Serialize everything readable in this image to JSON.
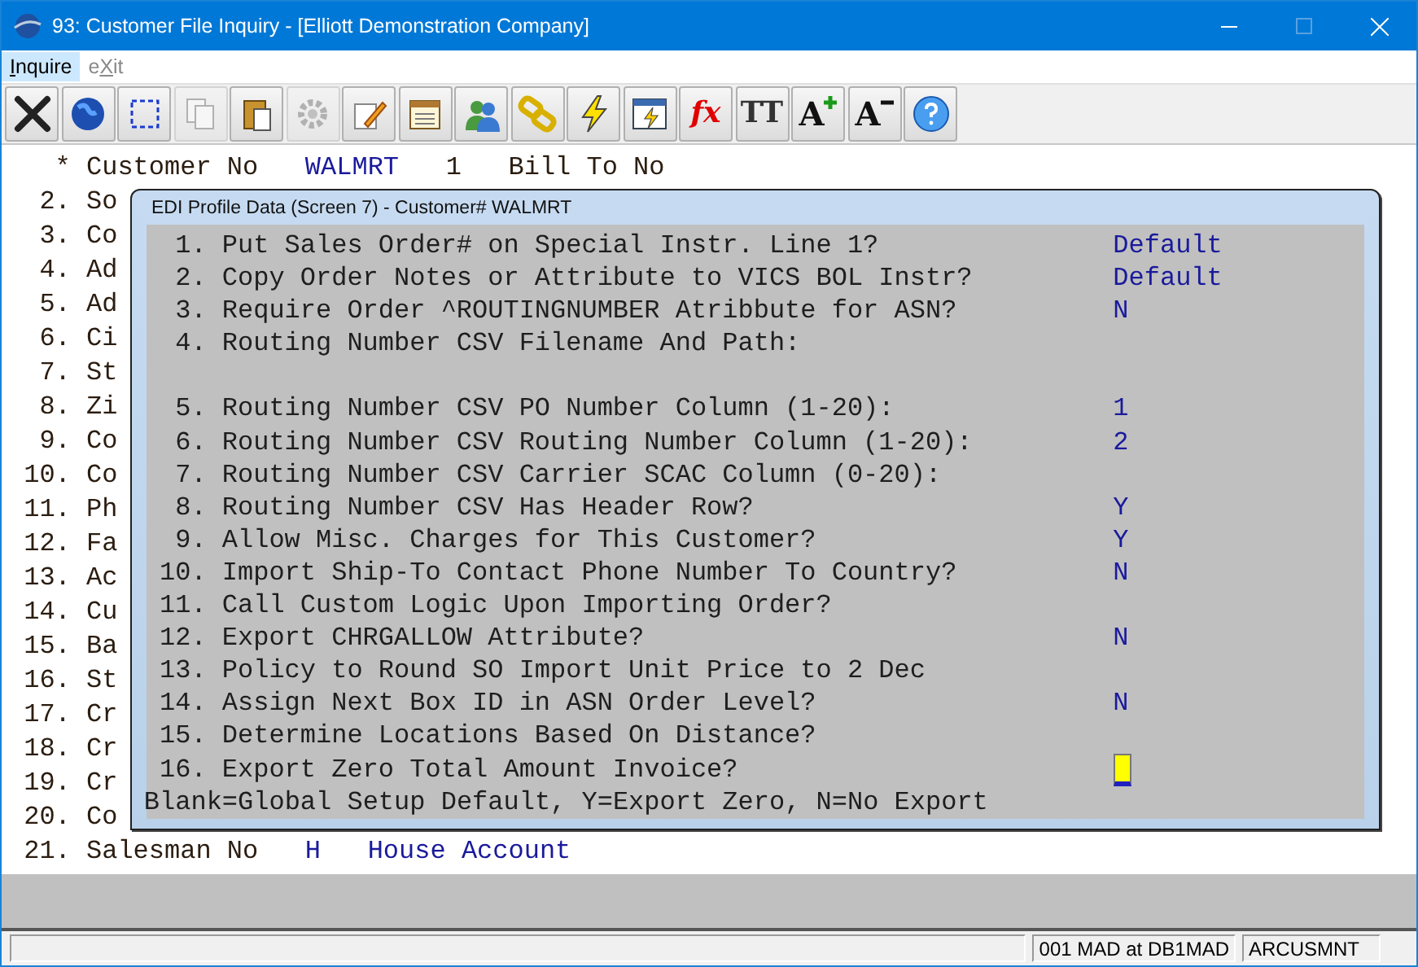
{
  "window": {
    "title": "93: Customer File Inquiry - [Elliott Demonstration Company]"
  },
  "menu": [
    {
      "key": "I",
      "after": "nquire",
      "selected": true,
      "disabled": false
    },
    {
      "before": "e",
      "key": "X",
      "after": "it",
      "selected": false,
      "disabled": true
    }
  ],
  "toolbar": [
    {
      "kind": "close",
      "disabled": false
    },
    {
      "kind": "globe",
      "disabled": false
    },
    {
      "kind": "select",
      "disabled": false
    },
    {
      "kind": "copy",
      "disabled": true
    },
    {
      "kind": "paste",
      "disabled": false
    },
    {
      "kind": "gear",
      "disabled": true
    },
    {
      "kind": "pencil",
      "disabled": false
    },
    {
      "kind": "list",
      "disabled": false
    },
    {
      "kind": "users",
      "disabled": false
    },
    {
      "kind": "link",
      "disabled": false
    },
    {
      "kind": "bolt",
      "disabled": false
    },
    {
      "kind": "window-bolt",
      "disabled": false
    },
    {
      "kind": "glyph",
      "glyph": "fx",
      "disabled": false
    },
    {
      "kind": "glyph",
      "glyph": "TT",
      "disabled": false
    },
    {
      "kind": "font-up",
      "glyph": "A",
      "disabled": false
    },
    {
      "kind": "font-down",
      "glyph": "A",
      "disabled": false
    },
    {
      "kind": "help",
      "disabled": false
    }
  ],
  "lines": [
    {
      "number": "*",
      "parts": [
        {
          "kind": "label",
          "text": "Customer No"
        },
        {
          "kind": "value",
          "text": "WALMRT"
        },
        {
          "kind": "label",
          "text": "1"
        },
        {
          "kind": "label",
          "text": "Bill To No"
        }
      ]
    },
    {
      "number": "2.",
      "parts": [
        {
          "kind": "label",
          "text": "So"
        }
      ]
    },
    {
      "number": "3.",
      "parts": [
        {
          "kind": "label",
          "text": "Co"
        }
      ]
    },
    {
      "number": "4.",
      "parts": [
        {
          "kind": "label",
          "text": "Ad"
        }
      ]
    },
    {
      "number": "5.",
      "parts": [
        {
          "kind": "label",
          "text": "Ad"
        }
      ]
    },
    {
      "number": "6.",
      "parts": [
        {
          "kind": "label",
          "text": "Ci"
        }
      ]
    },
    {
      "number": "7.",
      "parts": [
        {
          "kind": "label",
          "text": "St"
        }
      ]
    },
    {
      "number": "8.",
      "parts": [
        {
          "kind": "label",
          "text": "Zi"
        }
      ]
    },
    {
      "number": "9.",
      "parts": [
        {
          "kind": "label",
          "text": "Co"
        }
      ]
    },
    {
      "number": "10.",
      "parts": [
        {
          "kind": "label",
          "text": "Co"
        }
      ]
    },
    {
      "number": "11.",
      "parts": [
        {
          "kind": "label",
          "text": "Ph"
        }
      ]
    },
    {
      "number": "12.",
      "parts": [
        {
          "kind": "label",
          "text": "Fa"
        }
      ]
    },
    {
      "number": "13.",
      "parts": [
        {
          "kind": "label",
          "text": "Ac"
        }
      ]
    },
    {
      "number": "14.",
      "parts": [
        {
          "kind": "label",
          "text": "Cu"
        }
      ]
    },
    {
      "number": "15.",
      "parts": [
        {
          "kind": "label",
          "text": "Ba"
        }
      ]
    },
    {
      "number": "16.",
      "parts": [
        {
          "kind": "label",
          "text": "St"
        }
      ]
    },
    {
      "number": "17.",
      "parts": [
        {
          "kind": "label",
          "text": "Cr"
        }
      ]
    },
    {
      "number": "18.",
      "parts": [
        {
          "kind": "label",
          "text": "Cr"
        }
      ]
    },
    {
      "number": "19.",
      "parts": [
        {
          "kind": "label",
          "text": "Cr"
        }
      ]
    },
    {
      "number": "20.",
      "parts": [
        {
          "kind": "label",
          "text": "Co"
        }
      ]
    },
    {
      "number": "21.",
      "parts": [
        {
          "kind": "label",
          "text": "Salesman No"
        },
        {
          "kind": "value",
          "text": "H"
        },
        {
          "kind": "value",
          "text": "House Account"
        }
      ]
    }
  ],
  "dialog": {
    "title": "EDI Profile Data (Screen 7) - Customer# WALMRT",
    "items": [
      {
        "number": "1.",
        "label": "Put Sales Order# on Special Instr. Line 1?",
        "value": "Default",
        "kind": "field",
        "focused": false
      },
      {
        "number": "2.",
        "label": "Copy Order Notes or Attribute to VICS BOL Instr?",
        "value": "Default",
        "kind": "field",
        "focused": false
      },
      {
        "number": "3.",
        "label": "Require Order ^ROUTINGNUMBER Atribbute for ASN?",
        "value": "N",
        "kind": "field",
        "focused": false
      },
      {
        "number": "4.",
        "label": "Routing Number CSV Filename And Path:",
        "kind": "path",
        "focused": false
      },
      {
        "number": "5.",
        "label": "Routing Number CSV PO Number Column (1-20):",
        "value": "1",
        "kind": "field",
        "focused": false
      },
      {
        "number": "6.",
        "label": "Routing Number CSV Routing Number Column (1-20):",
        "value": "2",
        "kind": "field",
        "focused": false
      },
      {
        "number": "7.",
        "label": "Routing Number CSV Carrier SCAC Column (0-20):",
        "kind": "field",
        "focused": false
      },
      {
        "number": "8.",
        "label": "Routing Number CSV Has Header Row?",
        "value": "Y",
        "kind": "field",
        "focused": false
      },
      {
        "number": "9.",
        "label": "Allow Misc. Charges for This Customer?",
        "value": "Y",
        "kind": "field",
        "focused": false
      },
      {
        "number": "10.",
        "label": "Import Ship-To Contact Phone Number To Country?",
        "value": "N",
        "kind": "field",
        "focused": false
      },
      {
        "number": "11.",
        "label": "Call Custom Logic Upon Importing Order?",
        "kind": "field",
        "focused": false
      },
      {
        "number": "12.",
        "label": "Export CHRGALLOW Attribute?",
        "value": "N",
        "kind": "field",
        "focused": false
      },
      {
        "number": "13.",
        "label": "Policy to Round SO Import Unit Price to 2 Dec",
        "kind": "field",
        "focused": false
      },
      {
        "number": "14.",
        "label": "Assign Next Box ID in ASN Order Level?",
        "value": "N",
        "kind": "field",
        "focused": false
      },
      {
        "number": "15.",
        "label": "Determine Locations Based On Distance?",
        "kind": "field",
        "focused": false
      },
      {
        "number": "16.",
        "label": "Export Zero Total Amount Invoice?",
        "kind": "field",
        "focused": true
      }
    ],
    "hint": "Blank=Global Setup Default, Y=Export Zero, N=No Export"
  },
  "status_bar": [
    {
      "text": "001 MAD at DB1MAD"
    },
    {
      "text": "ARCUSMNT"
    }
  ]
}
